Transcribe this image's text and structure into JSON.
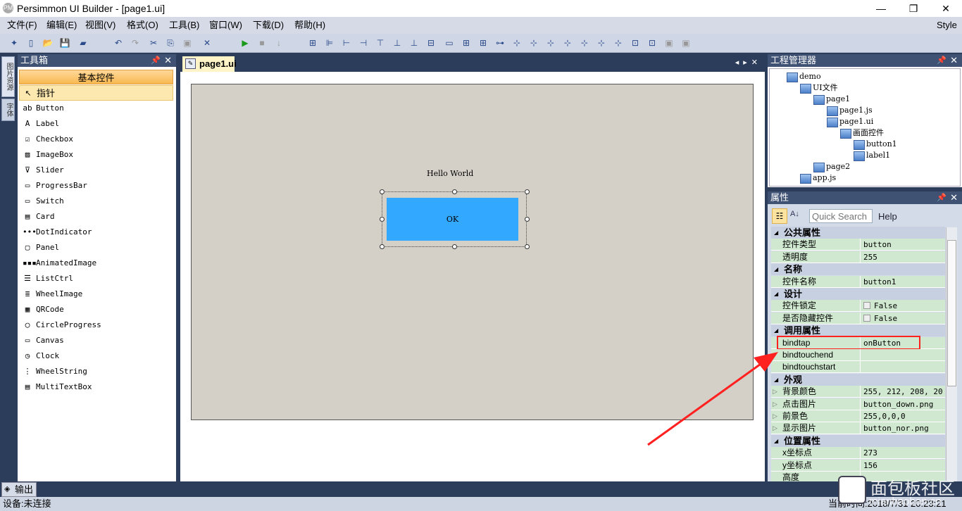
{
  "window": {
    "title": "Persimmon UI Builder - [page1.ui]",
    "logo": "PM",
    "minimize": "—",
    "maximize": "❐",
    "close": "✕"
  },
  "menu": [
    "文件(F)",
    "编辑(E)",
    "视图(V)",
    "格式(O)",
    "工具(B)",
    "窗口(W)",
    "下载(D)",
    "帮助(H)"
  ],
  "menu_right": "Style",
  "side_tabs": [
    "图片资源",
    "字体"
  ],
  "toolbox": {
    "title": "工具箱",
    "group": "基本控件",
    "items": [
      {
        "label": "指针",
        "icon": "pointer-icon",
        "g": "↖"
      },
      {
        "label": "Button",
        "icon": "button-icon",
        "g": "ab"
      },
      {
        "label": "Label",
        "icon": "label-icon",
        "g": "A"
      },
      {
        "label": "Checkbox",
        "icon": "checkbox-icon",
        "g": "☑"
      },
      {
        "label": "ImageBox",
        "icon": "image-icon",
        "g": "▨"
      },
      {
        "label": "Slider",
        "icon": "slider-icon",
        "g": "⊽"
      },
      {
        "label": "ProgressBar",
        "icon": "progressbar-icon",
        "g": "▭"
      },
      {
        "label": "Switch",
        "icon": "switch-icon",
        "g": "▭"
      },
      {
        "label": "Card",
        "icon": "card-icon",
        "g": "▤"
      },
      {
        "label": "DotIndicator",
        "icon": "dot-indicator-icon",
        "g": "•••"
      },
      {
        "label": "Panel",
        "icon": "panel-icon",
        "g": "▢"
      },
      {
        "label": "AnimatedImage",
        "icon": "animated-image-icon",
        "g": "▪▪▪"
      },
      {
        "label": "ListCtrl",
        "icon": "list-icon",
        "g": "☰"
      },
      {
        "label": "WheelImage",
        "icon": "wheel-image-icon",
        "g": "≣"
      },
      {
        "label": "QRCode",
        "icon": "qrcode-icon",
        "g": "▦"
      },
      {
        "label": "CircleProgress",
        "icon": "circle-progress-icon",
        "g": "◯"
      },
      {
        "label": "Canvas",
        "icon": "canvas-icon",
        "g": "▭"
      },
      {
        "label": "Clock",
        "icon": "clock-icon",
        "g": "◷"
      },
      {
        "label": "WheelString",
        "icon": "wheel-string-icon",
        "g": "⋮"
      },
      {
        "label": "MultiTextBox",
        "icon": "multitextbox-icon",
        "g": "▤"
      }
    ]
  },
  "document": {
    "tab": "page1.ui",
    "label_text": "Hello World",
    "button_text": "OK",
    "button_color": "#33a8ff",
    "canvas_color": "#d4d0c8"
  },
  "project": {
    "title": "工程管理器",
    "nodes": [
      {
        "label": "demo",
        "d": 0
      },
      {
        "label": "UI文件",
        "d": 1
      },
      {
        "label": "page1",
        "d": 2
      },
      {
        "label": "page1.js",
        "d": 3
      },
      {
        "label": "page1.ui",
        "d": 3
      },
      {
        "label": "画面控件",
        "d": 4
      },
      {
        "label": "button1",
        "d": 5
      },
      {
        "label": "label1",
        "d": 5
      },
      {
        "label": "page2",
        "d": 2
      },
      {
        "label": "app.js",
        "d": 1
      }
    ]
  },
  "properties": {
    "title": "属性",
    "search_placeholder": "Quick Search",
    "help": "Help",
    "rows": [
      {
        "cat": "公共属性"
      },
      {
        "k": "控件类型",
        "v": "button"
      },
      {
        "k": "透明度",
        "v": "255"
      },
      {
        "cat": "名称"
      },
      {
        "k": "控件名称",
        "v": "button1"
      },
      {
        "cat": "设计"
      },
      {
        "k": "控件锁定",
        "v": "False",
        "chk": true
      },
      {
        "k": "是否隐藏控件",
        "v": "False",
        "chk": true
      },
      {
        "cat": "调用属性"
      },
      {
        "k": "bindtap",
        "v": "onButton",
        "hl": true
      },
      {
        "k": "bindtouchend",
        "v": ""
      },
      {
        "k": "bindtouchstart",
        "v": ""
      },
      {
        "cat": "外观"
      },
      {
        "k": "背景颜色",
        "v": "255, 212, 208, 20",
        "exp": true
      },
      {
        "k": "点击图片",
        "v": "button_down.png",
        "exp": true
      },
      {
        "k": "前景色",
        "v": "255,0,0,0",
        "exp": true
      },
      {
        "k": "显示图片",
        "v": "button_nor.png",
        "exp": true
      },
      {
        "cat": "位置属性"
      },
      {
        "k": "x坐标点",
        "v": "273"
      },
      {
        "k": "y坐标点",
        "v": "156"
      },
      {
        "k": "高度",
        "v": ""
      }
    ]
  },
  "output_tab": "输出",
  "status": {
    "left": "设备:未连接",
    "right": "当前时间:2018/7/31 20:23:21"
  },
  "watermark": {
    "name": "面包板社区",
    "url": "mianbaoban.cn"
  },
  "annotation_color": "#ff2020"
}
